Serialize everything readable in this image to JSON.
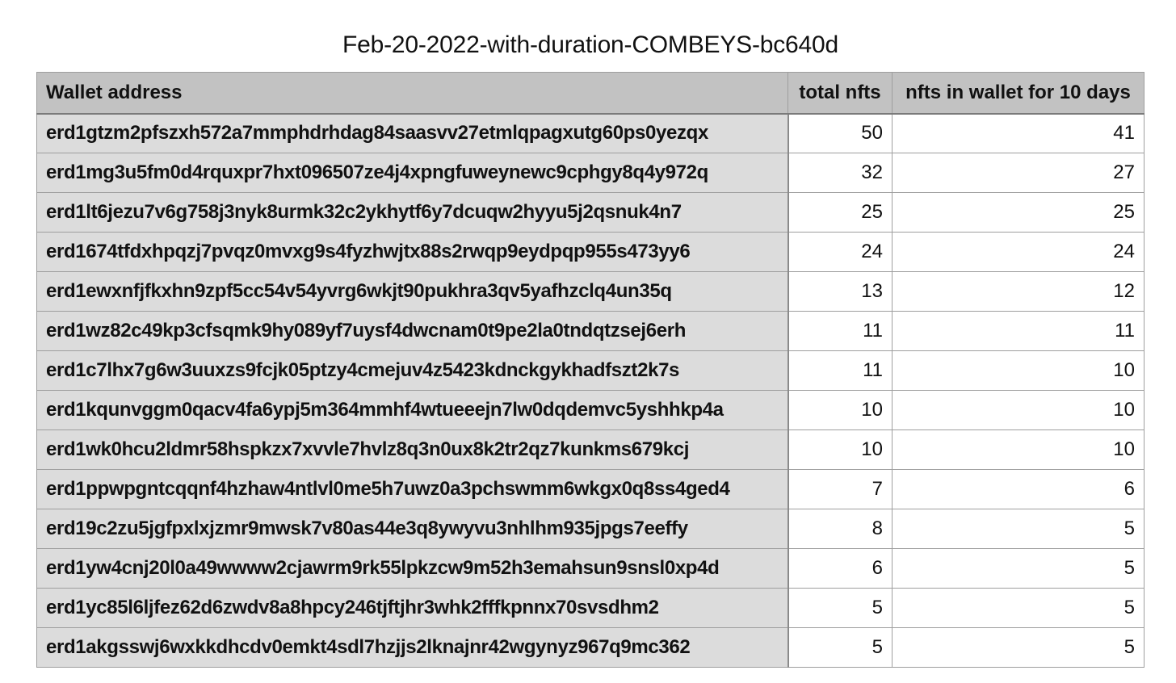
{
  "title": "Feb-20-2022-with-duration-COMBEYS-bc640d",
  "columns": [
    "Wallet address",
    "total nfts",
    "nfts in wallet for 10 days"
  ],
  "rows": [
    {
      "address": "erd1gtzm2pfszxh572a7mmphdrhdag84saasvv27etmlqpagxutg60ps0yezqx",
      "total": "50",
      "days": "41"
    },
    {
      "address": "erd1mg3u5fm0d4rquxpr7hxt096507ze4j4xpngfuweynewc9cphgy8q4y972q",
      "total": "32",
      "days": "27"
    },
    {
      "address": "erd1lt6jezu7v6g758j3nyk8urmk32c2ykhytf6y7dcuqw2hyyu5j2qsnuk4n7",
      "total": "25",
      "days": "25"
    },
    {
      "address": "erd1674tfdxhpqzj7pvqz0mvxg9s4fyzhwjtx88s2rwqp9eydpqp955s473yy6",
      "total": "24",
      "days": "24"
    },
    {
      "address": "erd1ewxnfjfkxhn9zpf5cc54v54yvrg6wkjt90pukhra3qv5yafhzclq4un35q",
      "total": "13",
      "days": "12"
    },
    {
      "address": "erd1wz82c49kp3cfsqmk9hy089yf7uysf4dwcnam0t9pe2la0tndqtzsej6erh",
      "total": "11",
      "days": "11"
    },
    {
      "address": "erd1c7lhx7g6w3uuxzs9fcjk05ptzy4cmejuv4z5423kdnckgykhadfszt2k7s",
      "total": "11",
      "days": "10"
    },
    {
      "address": "erd1kqunvggm0qacv4fa6ypj5m364mmhf4wtueeejn7lw0dqdemvc5yshhkp4a",
      "total": "10",
      "days": "10"
    },
    {
      "address": "erd1wk0hcu2ldmr58hspkzx7xvvle7hvlz8q3n0ux8k2tr2qz7kunkms679kcj",
      "total": "10",
      "days": "10"
    },
    {
      "address": "erd1ppwpgntcqqnf4hzhaw4ntlvl0me5h7uwz0a3pchswmm6wkgx0q8ss4ged4",
      "total": "7",
      "days": "6"
    },
    {
      "address": "erd19c2zu5jgfpxlxjzmr9mwsk7v80as44e3q8ywyvu3nhlhm935jpgs7eeffy",
      "total": "8",
      "days": "5"
    },
    {
      "address": "erd1yw4cnj20l0a49wwww2cjawrm9rk55lpkzcw9m52h3emahsun9snsl0xp4d",
      "total": "6",
      "days": "5"
    },
    {
      "address": "erd1yc85l6ljfez62d6zwdv8a8hpcy246tjftjhr3whk2fffkpnnx70svsdhm2",
      "total": "5",
      "days": "5"
    },
    {
      "address": "erd1akgsswj6wxkkdhcdv0emkt4sdl7hzjjs2lknajnr42wgynyz967q9mc362",
      "total": "5",
      "days": "5"
    }
  ]
}
